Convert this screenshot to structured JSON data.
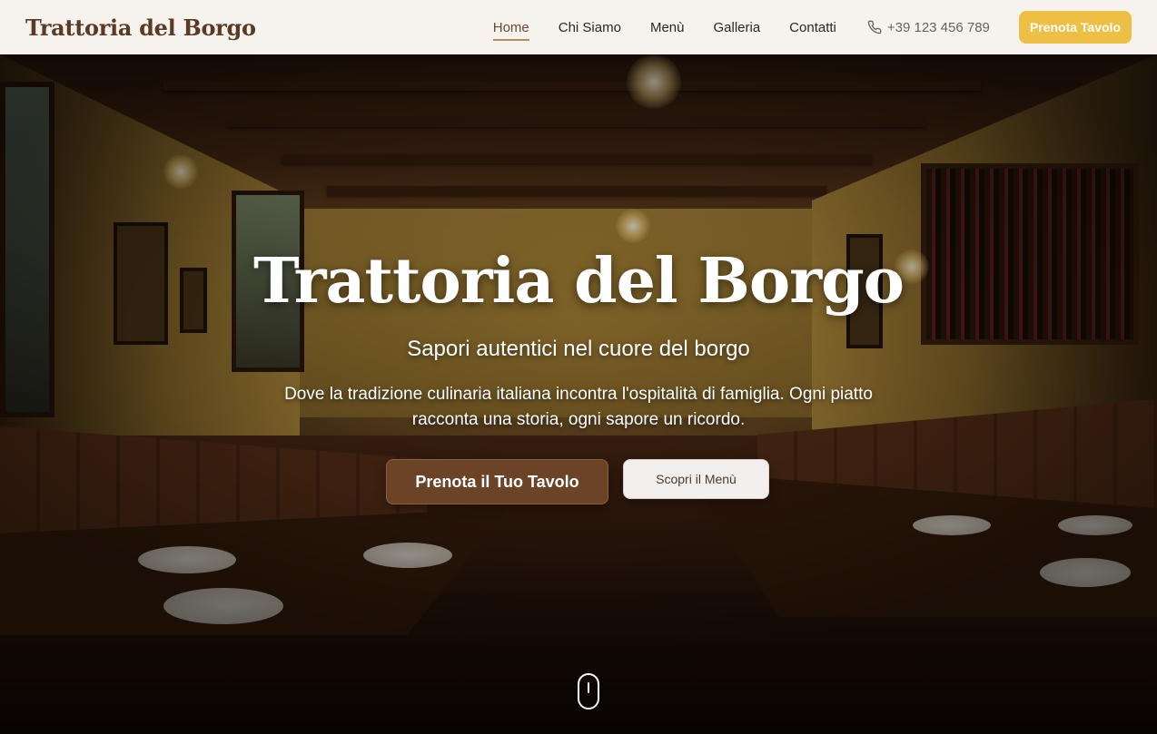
{
  "navbar": {
    "logo": "Trattoria del Borgo",
    "links": [
      {
        "label": "Home",
        "active": true
      },
      {
        "label": "Chi Siamo",
        "active": false
      },
      {
        "label": "Menù",
        "active": false
      },
      {
        "label": "Galleria",
        "active": false
      },
      {
        "label": "Contatti",
        "active": false
      }
    ],
    "phone": "+39 123 456 789",
    "phone_icon": "phone-icon",
    "cta": "Prenota Tavolo"
  },
  "hero": {
    "title": "Trattoria del Borgo",
    "subtitle": "Sapori autentici nel cuore del borgo",
    "description": "Dove la tradizione culinaria italiana incontra l'ospitalità di famiglia. Ogni piatto racconta una storia, ogni sapore un ricordo.",
    "primary_button": "Prenota il Tuo Tavolo",
    "secondary_button": "Scopri il Menù",
    "scroll_icon": "mouse-scroll-icon"
  },
  "colors": {
    "brand_brown": "#5a3a22",
    "cta_yellow": "#eebf45",
    "primary_button": "#6b4327"
  }
}
